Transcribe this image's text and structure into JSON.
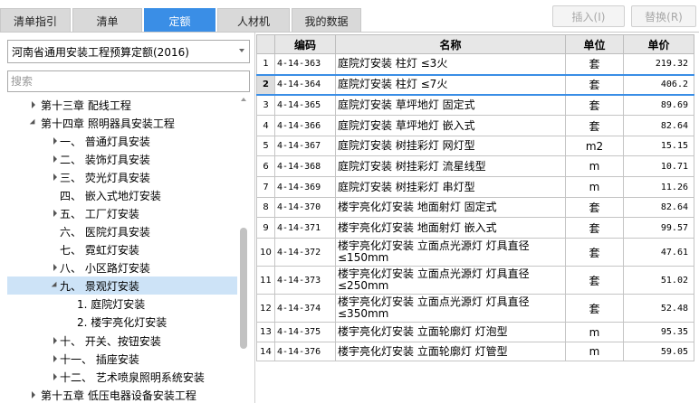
{
  "tabs": {
    "bill_guide": "清单指引",
    "bill": "清单",
    "quota": "定额",
    "labor_material_machine": "人材机",
    "my_data": "我的数据"
  },
  "toolbar": {
    "insert_label": "插入(I)",
    "replace_label": "替换(R)"
  },
  "library_select": {
    "value": "河南省通用安装工程预算定额(2016)"
  },
  "search": {
    "placeholder": "搜索"
  },
  "tree": [
    {
      "label": "第十三章 配线工程",
      "toggle": "collapsed"
    },
    {
      "label": "第十四章 照明器具安装工程",
      "toggle": "expanded"
    },
    {
      "label": "一、 普通灯具安装",
      "toggle": "collapsed"
    },
    {
      "label": "二、 装饰灯具安装",
      "toggle": "collapsed"
    },
    {
      "label": "三、 荧光灯具安装",
      "toggle": "collapsed"
    },
    {
      "label": "四、 嵌入式地灯安装",
      "toggle": "none"
    },
    {
      "label": "五、 工厂灯安装",
      "toggle": "collapsed"
    },
    {
      "label": "六、 医院灯具安装",
      "toggle": "none"
    },
    {
      "label": "七、 霓虹灯安装",
      "toggle": "none"
    },
    {
      "label": "八、 小区路灯安装",
      "toggle": "collapsed"
    },
    {
      "label": "九、 景观灯安装",
      "toggle": "expanded",
      "selected": true
    },
    {
      "label": "1. 庭院灯安装",
      "toggle": "none"
    },
    {
      "label": "2. 楼宇亮化灯安装",
      "toggle": "none"
    },
    {
      "label": "十、 开关、按钮安装",
      "toggle": "collapsed"
    },
    {
      "label": "十一、 插座安装",
      "toggle": "collapsed"
    },
    {
      "label": "十二、 艺术喷泉照明系统安装",
      "toggle": "collapsed"
    },
    {
      "label": "第十五章 低压电器设备安装工程",
      "toggle": "collapsed"
    }
  ],
  "table": {
    "headers": {
      "code": "编码",
      "name": "名称",
      "unit": "单位",
      "price": "单价"
    },
    "rows": [
      {
        "idx": "1",
        "code": "4-14-363",
        "name": "庭院灯安装 柱灯 ≤3火",
        "unit": "套",
        "price": "219.32"
      },
      {
        "idx": "2",
        "code": "4-14-364",
        "name": "庭院灯安装 柱灯 ≤7火",
        "unit": "套",
        "price": "406.2",
        "selected": true
      },
      {
        "idx": "3",
        "code": "4-14-365",
        "name": "庭院灯安装 草坪地灯 固定式",
        "unit": "套",
        "price": "89.69"
      },
      {
        "idx": "4",
        "code": "4-14-366",
        "name": "庭院灯安装 草坪地灯 嵌入式",
        "unit": "套",
        "price": "82.64"
      },
      {
        "idx": "5",
        "code": "4-14-367",
        "name": "庭院灯安装 树挂彩灯 网灯型",
        "unit": "m2",
        "price": "15.15"
      },
      {
        "idx": "6",
        "code": "4-14-368",
        "name": "庭院灯安装 树挂彩灯 流星线型",
        "unit": "m",
        "price": "10.71"
      },
      {
        "idx": "7",
        "code": "4-14-369",
        "name": "庭院灯安装 树挂彩灯 串灯型",
        "unit": "m",
        "price": "11.26"
      },
      {
        "idx": "8",
        "code": "4-14-370",
        "name": "楼宇亮化灯安装 地面射灯 固定式",
        "unit": "套",
        "price": "82.64"
      },
      {
        "idx": "9",
        "code": "4-14-371",
        "name": "楼宇亮化灯安装 地面射灯 嵌入式",
        "unit": "套",
        "price": "99.57"
      },
      {
        "idx": "10",
        "code": "4-14-372",
        "name": "楼宇亮化灯安装 立面点光源灯 灯具直径≤150mm",
        "unit": "套",
        "price": "47.61"
      },
      {
        "idx": "11",
        "code": "4-14-373",
        "name": "楼宇亮化灯安装 立面点光源灯 灯具直径≤250mm",
        "unit": "套",
        "price": "51.02"
      },
      {
        "idx": "12",
        "code": "4-14-374",
        "name": "楼宇亮化灯安装 立面点光源灯 灯具直径≤350mm",
        "unit": "套",
        "price": "52.48"
      },
      {
        "idx": "13",
        "code": "4-14-375",
        "name": "楼宇亮化灯安装 立面轮廓灯 灯泡型",
        "unit": "m",
        "price": "95.35"
      },
      {
        "idx": "14",
        "code": "4-14-376",
        "name": "楼宇亮化灯安装 立面轮廓灯 灯管型",
        "unit": "m",
        "price": "59.05"
      }
    ]
  },
  "colors": {
    "accent": "#3a8ee6",
    "tree_selection": "#cde3f7",
    "header_bg": "#e7e7e7"
  }
}
